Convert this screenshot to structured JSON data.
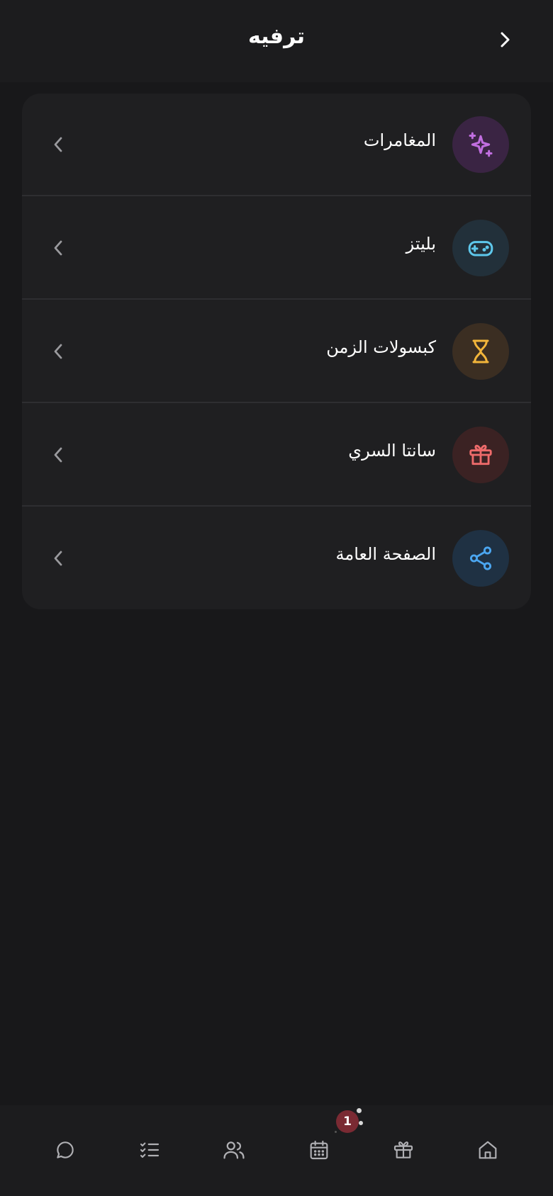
{
  "header": {
    "title": "ترفيه",
    "back_icon": "chevron-right-icon"
  },
  "menu": {
    "items": [
      {
        "label": "المغامرات",
        "icon": "sparkles-icon",
        "icon_color": "#c16ee0",
        "bg_color": "#3a2443"
      },
      {
        "label": "بليتز",
        "icon": "gamepad-icon",
        "icon_color": "#5ec8ec",
        "bg_color": "#22303a"
      },
      {
        "label": "كبسولات الزمن",
        "icon": "hourglass-icon",
        "icon_color": "#f2b53b",
        "bg_color": "#3b2e22"
      },
      {
        "label": "سانتا السري",
        "icon": "gift-icon",
        "icon_color": "#ee6b6b",
        "bg_color": "#3b2223"
      },
      {
        "label": "الصفحة العامة",
        "icon": "share-icon",
        "icon_color": "#4ba6f0",
        "bg_color": "#1f3143"
      }
    ],
    "chevron_icon": "chevron-left-icon"
  },
  "bottom_nav": {
    "items": [
      {
        "icon": "chat-bubble-icon"
      },
      {
        "icon": "checklist-icon"
      },
      {
        "icon": "users-icon"
      },
      {
        "icon": "calendar-icon",
        "badge": "1"
      },
      {
        "icon": "gift-icon"
      },
      {
        "icon": "home-icon"
      }
    ],
    "icon_color": "#b0b0b4",
    "badge_color": "#7a2a33"
  }
}
